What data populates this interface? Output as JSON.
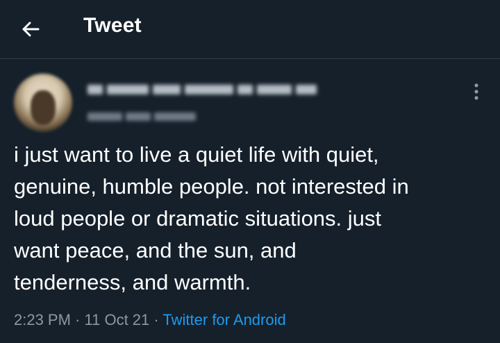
{
  "header": {
    "title": "Tweet"
  },
  "tweet": {
    "text_lines": [
      "i just want to live a quiet life with quiet,",
      "genuine, humble people. not interested in",
      "loud people or dramatic situations. just",
      "want peace, and the sun, and",
      "tenderness, and warmth."
    ],
    "time": "2:23 PM",
    "separator": " · ",
    "date": "11 Oct 21",
    "source": "Twitter for Android"
  },
  "icons": {
    "back": "arrow-left-icon",
    "more": "more-vertical-icon"
  },
  "colors": {
    "background": "#15202b",
    "text": "#ffffff",
    "secondary_text": "#8b98a5",
    "link": "#1d9bf0"
  }
}
